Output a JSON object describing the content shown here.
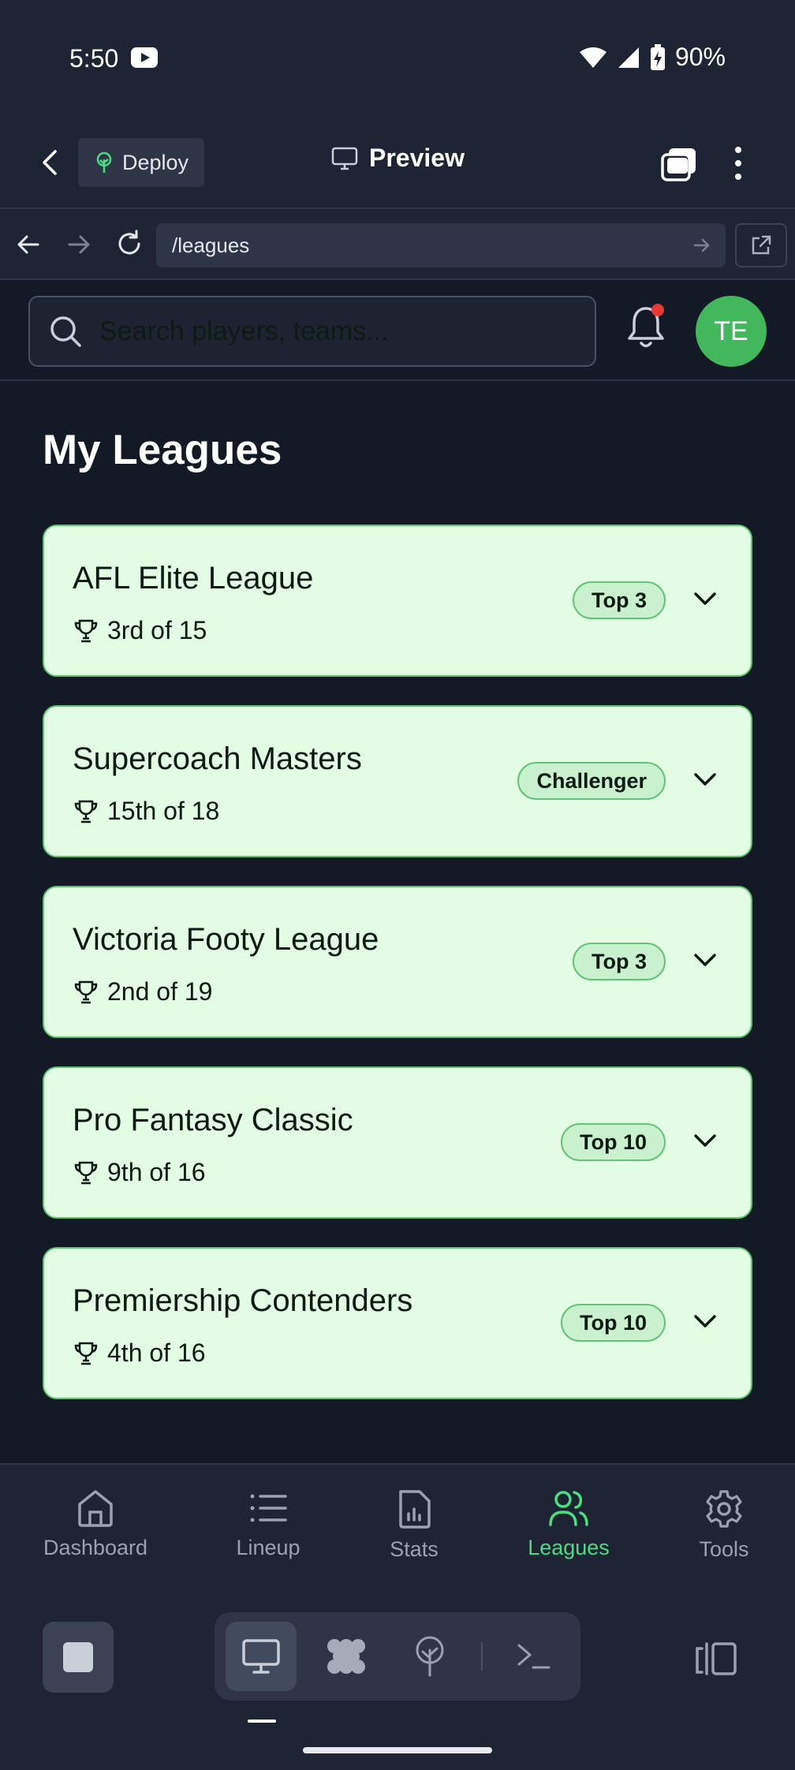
{
  "status_bar": {
    "time": "5:50",
    "battery": "90%",
    "icons": [
      "youtube-icon",
      "wifi-icon",
      "signal-icon",
      "battery-charging-icon"
    ]
  },
  "app_toolbar": {
    "deploy_label": "Deploy",
    "preview_label": "Preview"
  },
  "url_bar": {
    "url": "/leagues"
  },
  "page": {
    "search_placeholder": "Search players, teams...",
    "avatar_initials": "TE",
    "title": "My Leagues",
    "leagues": [
      {
        "name": "AFL Elite League",
        "rank": "3rd of 15",
        "badge": "Top 3"
      },
      {
        "name": "Supercoach Masters",
        "rank": "15th of 18",
        "badge": "Challenger"
      },
      {
        "name": "Victoria Footy League",
        "rank": "2nd of 19",
        "badge": "Top 3"
      },
      {
        "name": "Pro Fantasy Classic",
        "rank": "9th of 16",
        "badge": "Top 10"
      },
      {
        "name": "Premiership Contenders",
        "rank": "4th of 16",
        "badge": "Top 10"
      }
    ]
  },
  "bottom_nav": {
    "active": "Leagues",
    "items": [
      {
        "label": "Dashboard",
        "icon": "home-icon"
      },
      {
        "label": "Lineup",
        "icon": "list-icon"
      },
      {
        "label": "Stats",
        "icon": "chart-file-icon"
      },
      {
        "label": "Leagues",
        "icon": "users-icon"
      },
      {
        "label": "Tools",
        "icon": "gear-icon"
      }
    ]
  },
  "colors": {
    "accent": "#4ade80",
    "card_bg": "#e3fce4",
    "avatar_bg": "#43b75b",
    "page_bg": "#131a26",
    "chrome_bg": "#1e2433"
  }
}
